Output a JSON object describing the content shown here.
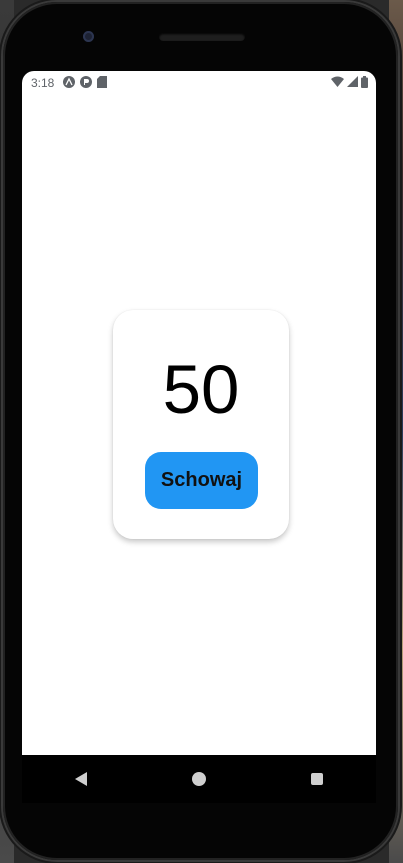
{
  "status_bar": {
    "time": "3:18",
    "left_icons": [
      "expo-icon",
      "app-notification-icon",
      "sd-card-icon"
    ],
    "right_icons": [
      "wifi-icon",
      "cell-signal-icon",
      "battery-icon"
    ]
  },
  "card": {
    "counter_value": "50",
    "hide_button_label": "Schowaj"
  },
  "nav_bar": {
    "buttons": [
      "back-icon",
      "home-icon",
      "recents-icon"
    ]
  },
  "colors": {
    "button": "#2196F3",
    "background": "#ffffff",
    "status_text": "#5f6368"
  }
}
